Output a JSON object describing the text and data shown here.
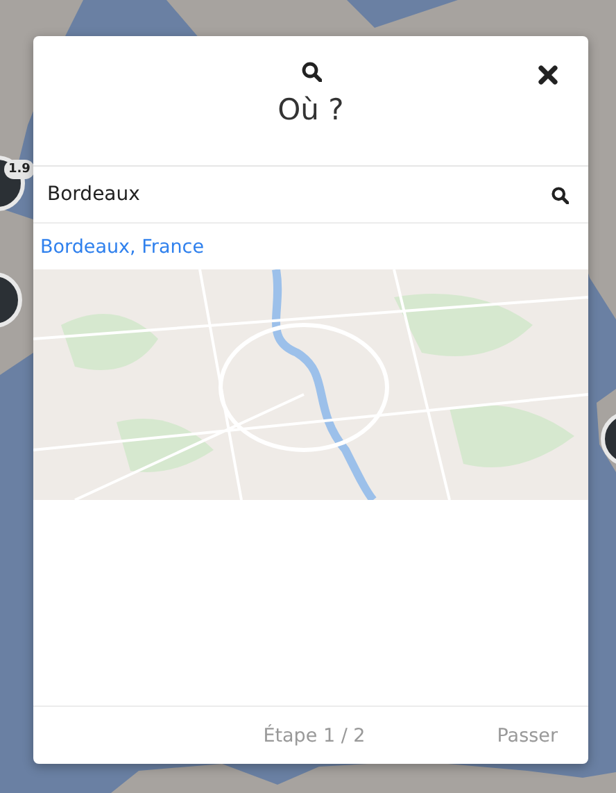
{
  "cluster_badge": "1.9",
  "dialog": {
    "title": "Où ?",
    "search": {
      "value": "Bordeaux"
    },
    "results": [
      {
        "label": "Bordeaux, France"
      }
    ],
    "footer": {
      "step": "Étape 1 / 2",
      "skip": "Passer"
    }
  }
}
